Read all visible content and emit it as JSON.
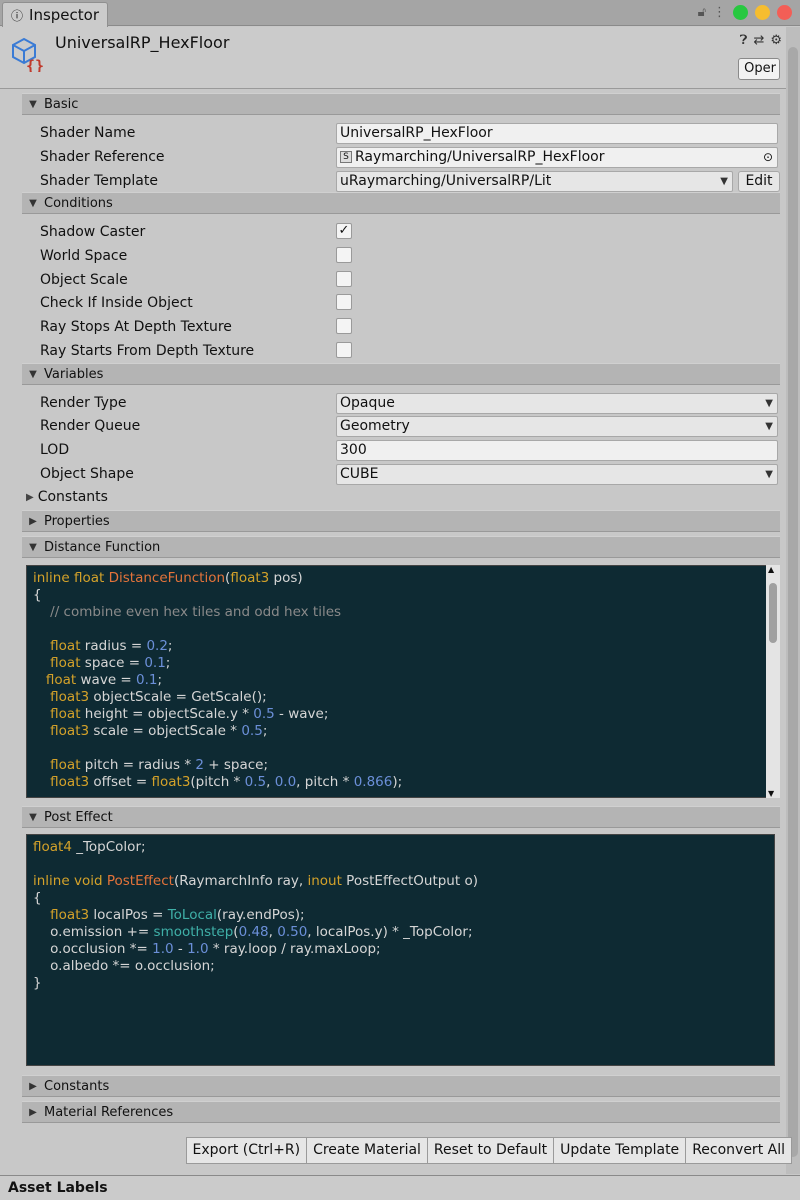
{
  "tab": {
    "title": "Inspector",
    "icon": "info-icon"
  },
  "header": {
    "title": "UniversalRP_HexFloor",
    "open_label": "Oper"
  },
  "sections": {
    "basic": "Basic",
    "conditions": "Conditions",
    "variables": "Variables",
    "properties": "Properties",
    "distance_function": "Distance Function",
    "post_effect": "Post Effect",
    "constants2": "Constants",
    "material_refs": "Material References"
  },
  "basic": {
    "shader_name_label": "Shader Name",
    "shader_name_value": "UniversalRP_HexFloor",
    "shader_ref_label": "Shader Reference",
    "shader_ref_value": "Raymarching/UniversalRP_HexFloor",
    "shader_template_label": "Shader Template",
    "shader_template_value": "uRaymarching/UniversalRP/Lit",
    "edit_label": "Edit"
  },
  "conditions": [
    {
      "label": "Shadow Caster",
      "checked": true
    },
    {
      "label": "World Space",
      "checked": false
    },
    {
      "label": "Object Scale",
      "checked": false
    },
    {
      "label": "Check If Inside Object",
      "checked": false
    },
    {
      "label": "Ray Stops At Depth Texture",
      "checked": false
    },
    {
      "label": "Ray Starts From Depth Texture",
      "checked": false
    }
  ],
  "variables": {
    "render_type_label": "Render Type",
    "render_type_value": "Opaque",
    "render_queue_label": "Render Queue",
    "render_queue_value": "Geometry",
    "lod_label": "LOD",
    "lod_value": "300",
    "object_shape_label": "Object Shape",
    "object_shape_value": "CUBE",
    "constants_label": "Constants"
  },
  "buttons": {
    "export": "Export (Ctrl+R)",
    "create_material": "Create Material",
    "reset": "Reset to Default",
    "update_template": "Update Template",
    "reconvert": "Reconvert All"
  },
  "footer": {
    "title": "Asset Labels"
  },
  "colors": {
    "code_bg": "#0e2a33",
    "keyword": "#d4a22a",
    "function": "#e4733a",
    "number": "#6b8fd8",
    "comment": "#8a8a8a",
    "type_teal": "#3fb0a8",
    "close_red": "#f35e56",
    "min_yellow": "#f6bd2f",
    "max_green": "#28c840"
  }
}
